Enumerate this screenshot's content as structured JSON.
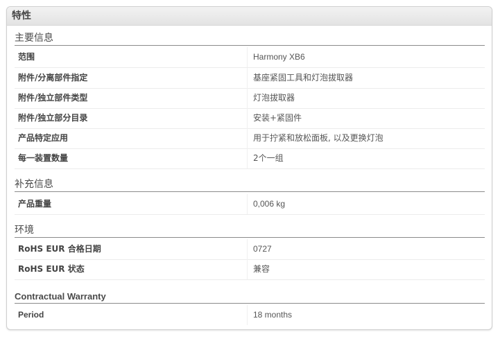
{
  "panel": {
    "title": "特性"
  },
  "sections": [
    {
      "title": "主要信息",
      "rows": [
        {
          "label": "范围",
          "value": "Harmony XB6"
        },
        {
          "label": "附件/分离部件指定",
          "value": "基座紧固工具和灯泡拔取器"
        },
        {
          "label": "附件/独立部件类型",
          "value": "灯泡拔取器"
        },
        {
          "label": "附件/独立部分目录",
          "value": "安装+紧固件"
        },
        {
          "label": "产品特定应用",
          "value": "用于拧紧和放松面板, 以及更换灯泡"
        },
        {
          "label": "每一装置数量",
          "value": "2个一组"
        }
      ]
    },
    {
      "title": "补充信息",
      "rows": [
        {
          "label": "产品重量",
          "value": "0,006 kg"
        }
      ]
    },
    {
      "title": "环境",
      "rows": [
        {
          "label": "RoHS EUR 合格日期",
          "value": "0727"
        },
        {
          "label": "RoHS EUR 状态",
          "value": "兼容"
        }
      ]
    },
    {
      "title": "Contractual Warranty",
      "rows": [
        {
          "label": "Period",
          "value": "18 months"
        }
      ]
    }
  ]
}
